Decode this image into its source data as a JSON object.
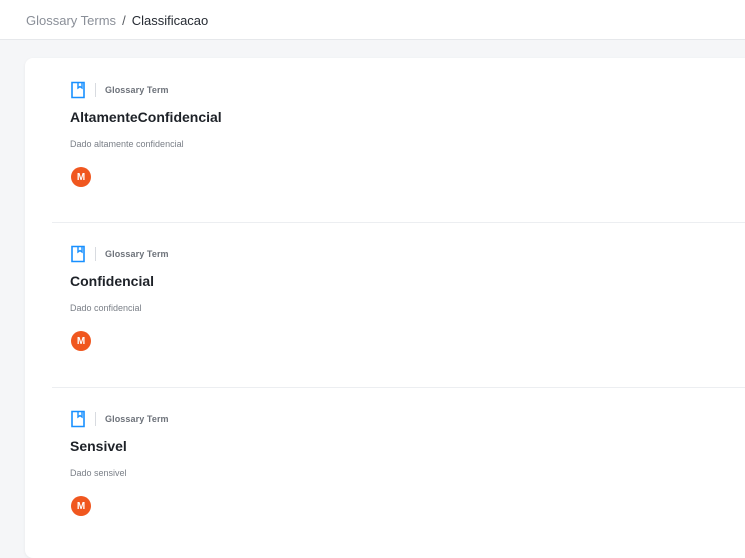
{
  "breadcrumb": {
    "parent": "Glossary Terms",
    "separator": "/",
    "current": "Classificacao"
  },
  "results": [
    {
      "icon": "glossary-term-icon",
      "type": "Glossary Term",
      "title": "AltamenteConfidencial",
      "description": "Dado altamente confidencial",
      "owner_initial": "M"
    },
    {
      "icon": "glossary-term-icon",
      "type": "Glossary Term",
      "title": "Confidencial",
      "description": "Dado confidencial",
      "owner_initial": "M"
    },
    {
      "icon": "glossary-term-icon",
      "type": "Glossary Term",
      "title": "Sensivel",
      "description": "Dado sensivel",
      "owner_initial": "M"
    }
  ],
  "colors": {
    "accent": "#1890ff",
    "avatar": "#f0571f"
  }
}
